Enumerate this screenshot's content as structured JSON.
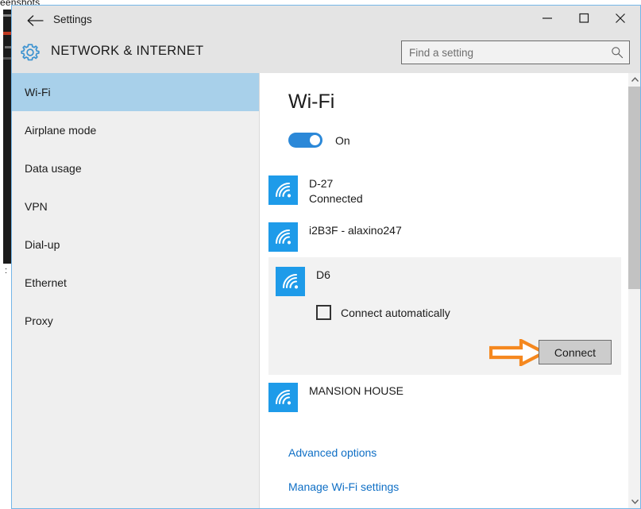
{
  "desktop": {
    "clipped_text": "eenshots"
  },
  "window": {
    "title": "Settings",
    "back_icon": "back-arrow-icon",
    "minimize_label": "─",
    "maximize_label": "□",
    "close_label": "✕"
  },
  "header": {
    "gear_icon": "gear-icon",
    "category": "NETWORK & INTERNET",
    "search": {
      "placeholder": "Find a setting",
      "value": "",
      "icon": "search-icon"
    }
  },
  "sidebar": {
    "items": [
      {
        "label": "Wi-Fi",
        "active": true
      },
      {
        "label": "Airplane mode",
        "active": false
      },
      {
        "label": "Data usage",
        "active": false
      },
      {
        "label": "VPN",
        "active": false
      },
      {
        "label": "Dial-up",
        "active": false
      },
      {
        "label": "Ethernet",
        "active": false
      },
      {
        "label": "Proxy",
        "active": false
      }
    ]
  },
  "content": {
    "page_title": "Wi-Fi",
    "toggle": {
      "state_label": "On",
      "on": true
    },
    "networks": [
      {
        "name": "D-27",
        "status": "Connected",
        "expanded": false,
        "icon": "wifi-signal-icon"
      },
      {
        "name": "i2B3F - alaxino247",
        "status": "",
        "expanded": false,
        "icon": "wifi-signal-icon"
      },
      {
        "name": "D6",
        "status": "",
        "expanded": true,
        "icon": "wifi-signal-icon"
      },
      {
        "name": "MANSION HOUSE",
        "status": "",
        "expanded": false,
        "icon": "wifi-signal-icon"
      }
    ],
    "expanded_panel": {
      "network_name": "D6",
      "checkbox_label": "Connect automatically",
      "checkbox_checked": false,
      "connect_button": "Connect",
      "annotation_icon": "orange-arrow-pointer"
    },
    "links": [
      {
        "label": "Advanced options"
      },
      {
        "label": "Manage Wi-Fi settings"
      }
    ]
  },
  "scrollbar": {
    "up_arrow": "▲",
    "down_arrow": "▼"
  },
  "colors": {
    "accent_blue": "#1e9be9",
    "toggle_blue": "#2b88d8",
    "sidebar_selection": "#a8d0ea",
    "link_blue": "#0f6fc5",
    "annotation_orange": "#f5881f",
    "window_border": "#74b6e8",
    "chrome_gray": "#e4e4e4",
    "panel_gray": "#f2f2f2"
  }
}
